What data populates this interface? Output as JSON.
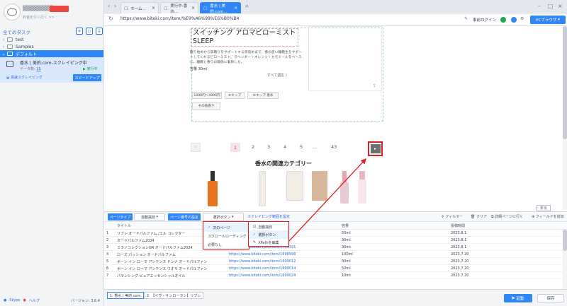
{
  "app": {
    "plan_text": "料金を引く行く >>",
    "version": "バージョン: 3.6.4"
  },
  "sidebar": {
    "section_title": "全てのタスク",
    "tree": [
      {
        "label": "test",
        "expanded": false
      },
      {
        "label": "Samples",
        "expanded": false
      },
      {
        "label": "デフォルト",
        "expanded": true,
        "selected": true
      }
    ],
    "task": {
      "name": "香水 | 美的.com-スクレイピング中",
      "count_label": "データ数:",
      "count_value": "35",
      "run_status": "実行中",
      "mode": "高速スクレイピング",
      "speed_button": "スピードアップ"
    },
    "footer": {
      "skype": "Skype",
      "help": "ヘルプ"
    }
  },
  "tabs": [
    {
      "label": "ホーム…",
      "active": false
    },
    {
      "label": "実行中-香水…",
      "active": false
    },
    {
      "label": "香水 | 美的.com…",
      "active": true
    }
  ],
  "address": {
    "url": "https://www.biteki.com/item/%E9%A6%99%E6%B0%B4",
    "login": "事前ログイン",
    "browser_button": "PCブラウザ"
  },
  "page": {
    "product_title_l1": "スイッチング アロマピローミスト",
    "product_title_l2": "SLEEP",
    "description": "眠り始めから質眠りをサポートする目覚めまで、癒の良い睡眠生をサポートしてくれるピローミスト。ラベンダー・オレンジ・カモミールをベースに、睡眠と香りの関係に着目した。",
    "volume": "容量 30ml",
    "read_more": "すべて読む",
    "chips": [
      "1000円〜4999円",
      "エキップ",
      "エキップ 香水",
      "その他香り"
    ],
    "pages": [
      "1",
      "2",
      "3",
      "4",
      "5",
      "...",
      "43"
    ],
    "related_title": "香水の関連カテゴリー",
    "fold_label": "折る"
  },
  "toolbar": {
    "page_type_btn": "ページタイプ",
    "page_type_value": "自動識別",
    "page_turn_btn": "ページ番号の設定",
    "select_btn_value": "選択ボタン",
    "scrape_range_link": "スクレイピング範囲を設定",
    "filter": "フィルター",
    "clear": "クリア",
    "go_detail": "詳細ページに行く",
    "add_field": "フィールドを追加"
  },
  "dropdown_pagetype": {
    "items": [
      "次のページ",
      "スクロールローディング",
      "必要なし"
    ],
    "selected": 0
  },
  "dropdown_button": {
    "items": [
      "自動識別",
      "選択ボタン",
      "XPathを編集"
    ],
    "selected": 1
  },
  "table": {
    "headers": [
      "タイトル",
      "",
      "容量",
      "投稿時間"
    ],
    "rows": [
      {
        "n": "1",
        "title": "リブレ オードパルファム /エル コレクター",
        "link": "",
        "vol": "50ml",
        "date": "2023.8.1"
      },
      {
        "n": "2",
        "title": "オードパルファム2024",
        "link": "",
        "vol": "30ml",
        "date": "2023.8.1"
      },
      {
        "n": "3",
        "title": "ミラノコレクションGR オードパルファム2024",
        "link": "https://www.biteki.com/item/1709191",
        "vol": "30ml",
        "date": "2023.8.1"
      },
      {
        "n": "4",
        "title": "ローズ パッション オードパルファム",
        "link": "https://www.biteki.com/item/1698998",
        "vol": "100ml",
        "date": "2023.7.20"
      },
      {
        "n": "5",
        "title": "ボーン イン ローマ アンテンス ドンナ オードパルファン",
        "link": "https://www.biteki.com/item/1699012",
        "vol": "30ml",
        "date": "2023.7.20"
      },
      {
        "n": "6",
        "title": "ボーン イン ローマ アンテンス ウオモ オードパルファン",
        "link": "https://www.biteki.com/item/1699014",
        "vol": "50ml",
        "date": "2023.7.20"
      },
      {
        "n": "7",
        "title": "パランシング ピュアエッセンシャルオイル",
        "link": "https://www.biteki.com/item/1699024",
        "vol": "10ml",
        "date": "2023.7.20"
      }
    ]
  },
  "status_tabs": [
    "1. 香水 | 美的.com",
    "2. 【イヴ・サンローラン】リブレ"
  ],
  "status_buttons": {
    "start": "起動",
    "save": "保存"
  }
}
